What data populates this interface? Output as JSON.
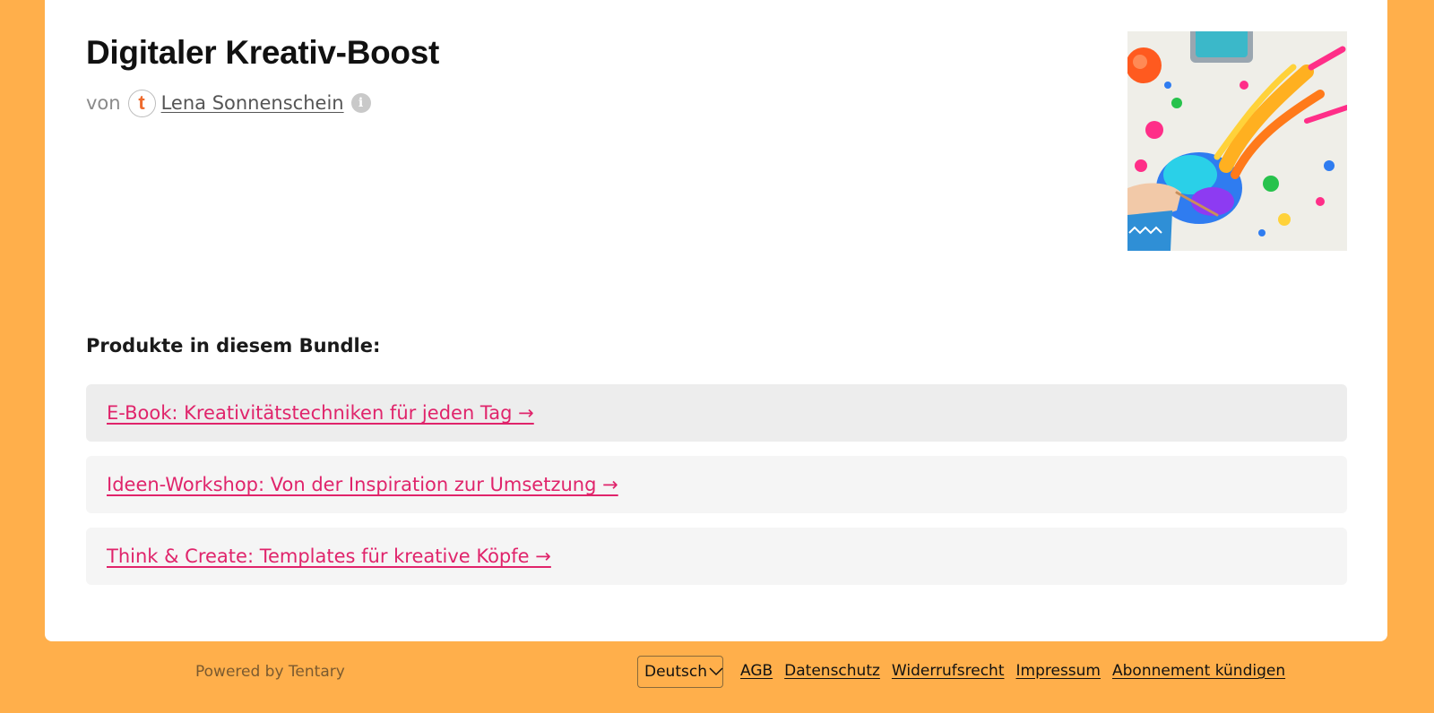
{
  "bundle": {
    "title": "Digitaler Kreativ-Boost",
    "by_prefix": "von",
    "author_avatar_letter": "t",
    "author_name": "Lena Sonnenschein",
    "cover_image_icon": "paint-splash-image"
  },
  "products_section": {
    "label": "Produkte in diesem Bundle:",
    "items": [
      {
        "label": "E-Book: Kreativitätstechniken für jeden Tag →"
      },
      {
        "label": "Ideen-Workshop: Von der Inspiration zur Umsetzung →"
      },
      {
        "label": "Think & Create: Templates für kreative Köpfe →"
      }
    ]
  },
  "footer": {
    "powered_by": "Powered by Tentary",
    "language_selected": "Deutsch",
    "links": {
      "agb": "AGB",
      "datenschutz": "Datenschutz",
      "widerrufsrecht": "Widerrufsrecht",
      "impressum": "Impressum",
      "abonnement": "Abonnement kündigen"
    }
  },
  "colors": {
    "page_background": "#FFAF4B",
    "card_background": "#FFFFFF",
    "link_accent": "#E0246B",
    "avatar_letter": "#EE6A2C"
  }
}
